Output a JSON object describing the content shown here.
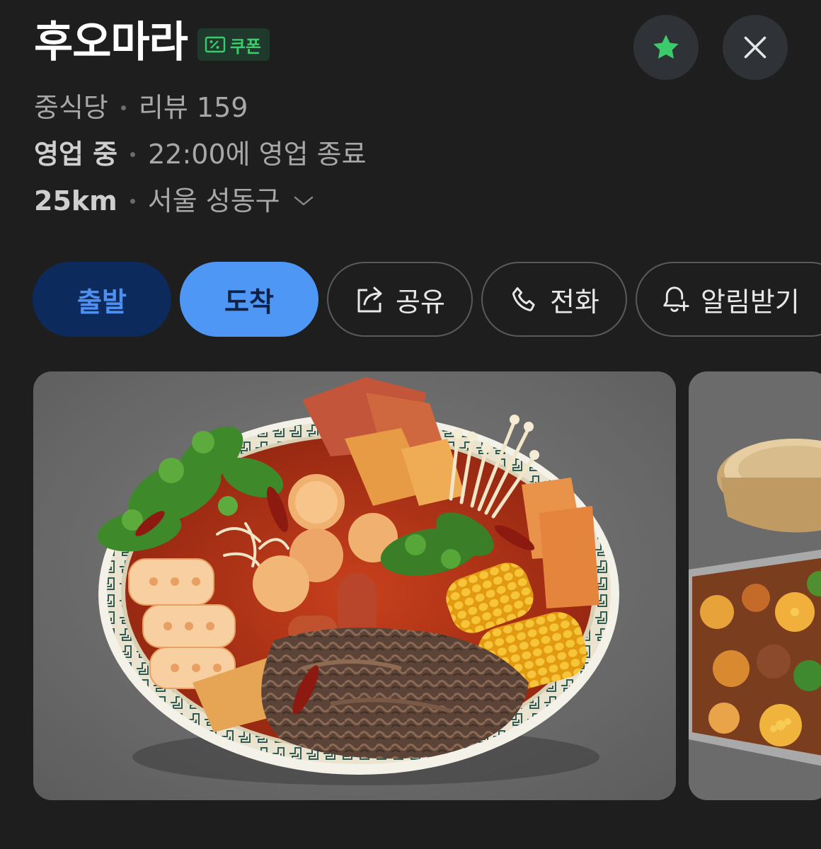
{
  "header": {
    "title": "후오마라",
    "coupon_label": "쿠폰",
    "coupon_icon": "coupon-percent-icon",
    "favorite_icon": "star-icon",
    "close_icon": "close-icon",
    "accent_color": "#3ccb6b"
  },
  "info": {
    "category": "중식당",
    "reviews": "리뷰 159",
    "status": "영업 중",
    "hours": "22:00에 영업 종료",
    "distance": "25km",
    "location": "서울 성동구"
  },
  "actions": [
    {
      "label": "출발",
      "icon": ""
    },
    {
      "label": "도착",
      "icon": ""
    },
    {
      "label": "공유",
      "icon": "share-icon"
    },
    {
      "label": "전화",
      "icon": "phone-icon"
    },
    {
      "label": "알림받기",
      "icon": "bell-plus-icon"
    }
  ],
  "photos": [
    {
      "subject": "malatang-bowl"
    },
    {
      "subject": "steamer-and-tray"
    }
  ]
}
